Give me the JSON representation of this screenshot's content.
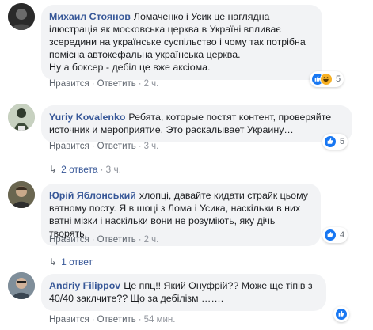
{
  "comments": [
    {
      "author": "Михаил Стоянов",
      "text": "Ломаченко і Усик це наглядна ілюстрація як московська церква в Україні впливає зсередини на українське суспільство і чому так потрібна помісна автокефальна українська церква.",
      "text2": "Ну а боксер - дебіл це вже аксіома.",
      "like_label": "Нравится",
      "reply_label": "Ответить",
      "time": "2 ч.",
      "reaction_count": "5",
      "reactions": [
        "like-icon",
        "haha-icon"
      ]
    },
    {
      "author": "Yuriy Kovalenko",
      "text": "Ребята, которые постят контент, проверяйте источник и мероприятие. Это раскалывает Украину…",
      "like_label": "Нравится",
      "reply_label": "Ответить",
      "time": "3 ч.",
      "reaction_count": "5",
      "reactions": [
        "like-icon"
      ],
      "replies_label": "2 ответа",
      "replies_time": "3 ч."
    },
    {
      "author": "Юрій Яблонський",
      "text": "хлопці, давайте кидати страйк цьому ватному посту. Я в шоці з Лома і Усика, наскільки в них ватні мізки і наскільки вони не розуміють, яку дічь творять.",
      "like_label": "Нравится",
      "reply_label": "Ответить",
      "time": "2 ч.",
      "reaction_count": "4",
      "reactions": [
        "like-icon"
      ],
      "replies_label": "1 ответ"
    },
    {
      "author": "Andriy Filippov",
      "text": "Це ппц!! Який Онуфрій?? Може ще тіпів з 40/40 заклчите?? Що за дебілізм …….",
      "like_label": "Нравится",
      "reply_label": "Ответить",
      "time": "54 мин.",
      "reactions": [
        "like-icon"
      ]
    }
  ],
  "colors": {
    "author": "#385898",
    "bubble": "#f2f3f5",
    "meta": "#90949c",
    "like": "#1877f2",
    "haha": "#f7b125"
  }
}
